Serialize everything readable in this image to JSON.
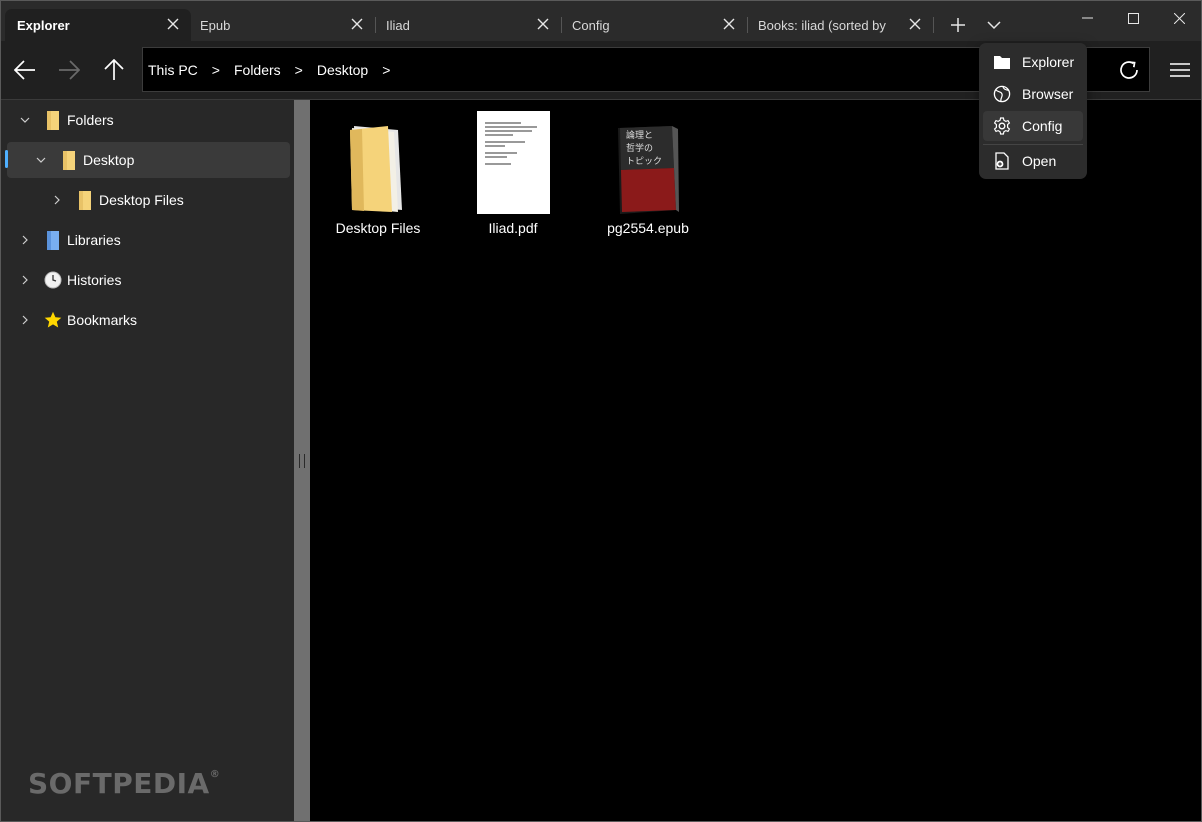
{
  "tabs": [
    {
      "label": "Explorer",
      "active": true
    },
    {
      "label": "Epub",
      "active": false
    },
    {
      "label": "Iliad",
      "active": false
    },
    {
      "label": "Config",
      "active": false
    },
    {
      "label": "Books: iliad (sorted by popularity)",
      "active": false
    }
  ],
  "breadcrumb": [
    "This PC",
    "Folders",
    "Desktop"
  ],
  "breadcrumb_separator": ">",
  "sidebar": {
    "items": [
      {
        "label": "Folders",
        "icon": "folder-icon",
        "expanded": true
      },
      {
        "label": "Desktop",
        "icon": "folder-icon",
        "expanded": true,
        "selected": true
      },
      {
        "label": "Desktop Files",
        "icon": "folder-icon",
        "expanded": false
      },
      {
        "label": "Libraries",
        "icon": "library-icon",
        "expanded": false
      },
      {
        "label": "Histories",
        "icon": "clock-icon",
        "expanded": false
      },
      {
        "label": "Bookmarks",
        "icon": "star-icon",
        "expanded": false
      }
    ]
  },
  "files": [
    {
      "name": "Desktop Files",
      "type": "folder"
    },
    {
      "name": "Iliad.pdf",
      "type": "pdf"
    },
    {
      "name": "pg2554.epub",
      "type": "epub",
      "cover_text": [
        "論理と",
        "哲学の",
        "トピック"
      ]
    }
  ],
  "dropdown_menu": {
    "items": [
      {
        "label": "Explorer",
        "icon": "folder-icon"
      },
      {
        "label": "Browser",
        "icon": "globe-icon"
      },
      {
        "label": "Config",
        "icon": "gear-icon"
      },
      {
        "label": "Open",
        "icon": "open-file-icon"
      }
    ]
  },
  "watermark": {
    "text": "SOFTPEDIA",
    "mark": "®"
  },
  "colors": {
    "accent": "#4fb0ff",
    "folder": "#f5d37a",
    "star": "#ffd700",
    "epub_cover": "#8b1a1a"
  }
}
